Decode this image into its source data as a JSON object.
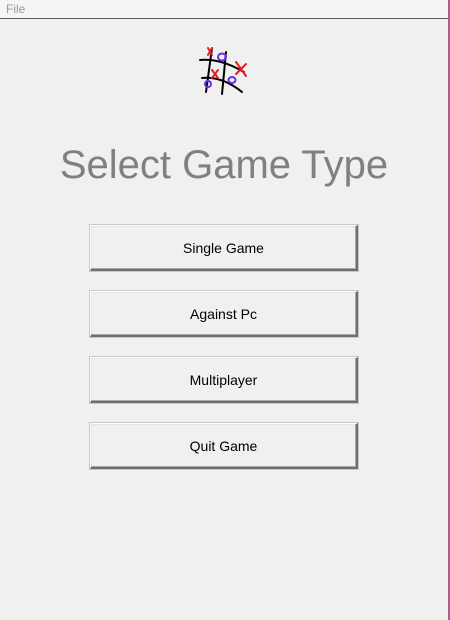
{
  "menubar": {
    "file_label": "File"
  },
  "logo": {
    "icon": "tic-tac-toe-icon",
    "colors": {
      "grid": "#000000",
      "x": "#e02020",
      "o": "#6a2df0"
    }
  },
  "main": {
    "title": "Select Game Type",
    "buttons": [
      {
        "label": "Single Game"
      },
      {
        "label": "Against Pc"
      },
      {
        "label": "Multiplayer"
      },
      {
        "label": "Quit Game"
      }
    ]
  },
  "colors": {
    "background": "#f0f0f0",
    "title_text": "#808080",
    "window_edge": "#b25a95"
  }
}
